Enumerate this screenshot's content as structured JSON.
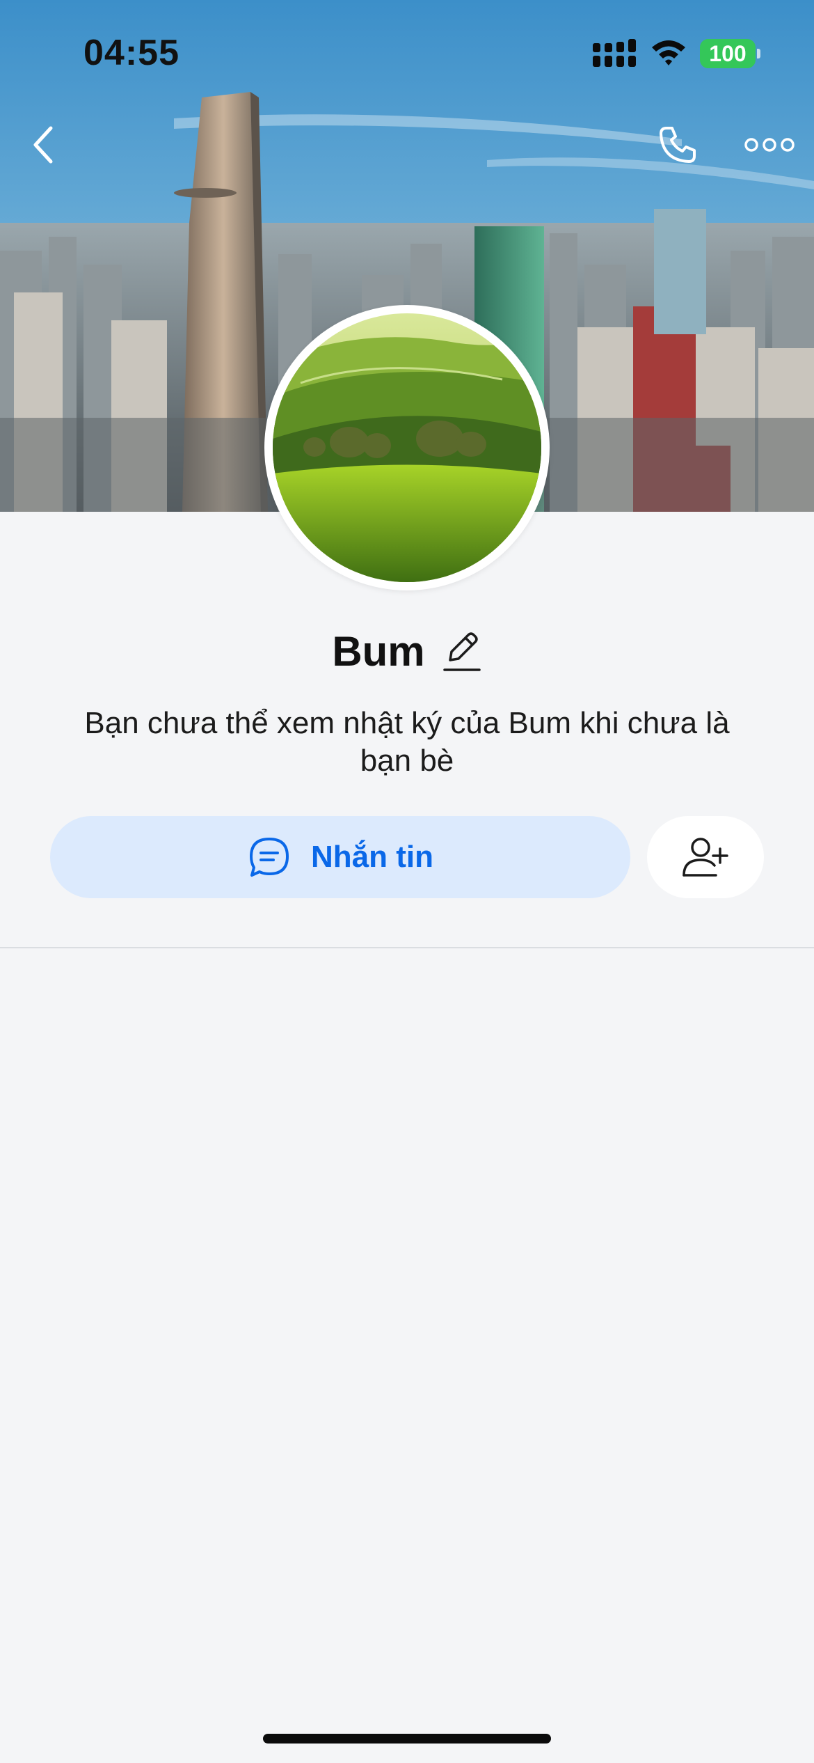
{
  "status_bar": {
    "time": "04:55",
    "battery": "100",
    "signal_icon": "cellular-signal-icon",
    "wifi_icon": "wifi-icon"
  },
  "nav": {
    "back_icon": "chevron-left-icon",
    "call_icon": "phone-icon",
    "more_icon": "more-horizontal-icon"
  },
  "profile": {
    "name": "Bum",
    "edit_icon": "pencil-icon",
    "notice": "Bạn chưa thể xem nhật ký của Bum khi chưa là bạn bè"
  },
  "actions": {
    "message_label": "Nhắn tin",
    "message_icon": "chat-bubble-icon",
    "add_friend_icon": "add-user-icon"
  },
  "colors": {
    "accent": "#0a68e8",
    "message_button_bg": "#dceafd",
    "battery_green": "#34c759",
    "page_bg": "#f4f5f7"
  }
}
